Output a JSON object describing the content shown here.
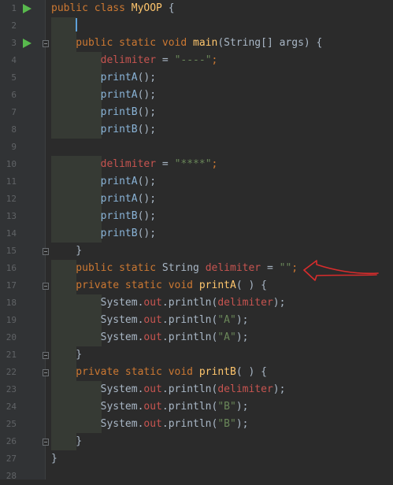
{
  "editor": {
    "line_numbers": [
      "1",
      "2",
      "3",
      "4",
      "5",
      "6",
      "7",
      "8",
      "9",
      "10",
      "11",
      "12",
      "13",
      "14",
      "15",
      "16",
      "17",
      "18",
      "19",
      "20",
      "21",
      "22",
      "23",
      "24",
      "25",
      "26",
      "27",
      "28"
    ],
    "gutter_icons": {
      "run": "run-icon",
      "fold": "fold-icon"
    },
    "lines": {
      "l1": {
        "a": "public class ",
        "b": "MyOOP",
        "c": " {"
      },
      "l3": {
        "a": "    public static void ",
        "b": "main",
        "c": "(String[] args) {"
      },
      "l4": {
        "a": "        ",
        "b": "delimiter",
        "c": " = ",
        "d": "\"----\"",
        "e": ";"
      },
      "l5": {
        "a": "        ",
        "b": "printA",
        "c": "();"
      },
      "l6": {
        "a": "        ",
        "b": "printA",
        "c": "();"
      },
      "l7": {
        "a": "        ",
        "b": "printB",
        "c": "();"
      },
      "l8": {
        "a": "        ",
        "b": "printB",
        "c": "();"
      },
      "l10": {
        "a": "        ",
        "b": "delimiter",
        "c": " = ",
        "d": "\"****\"",
        "e": ";"
      },
      "l11": {
        "a": "        ",
        "b": "printA",
        "c": "();"
      },
      "l12": {
        "a": "        ",
        "b": "printA",
        "c": "();"
      },
      "l13": {
        "a": "        ",
        "b": "printB",
        "c": "();"
      },
      "l14": {
        "a": "        ",
        "b": "printB",
        "c": "();"
      },
      "l15": {
        "a": "    }"
      },
      "l16": {
        "a": "    public static ",
        "b": "String ",
        "c": "delimiter",
        "d": " = ",
        "e": "\"\"",
        "f": ";"
      },
      "l17": {
        "a": "    private static void ",
        "b": "printA",
        "c": "( ) {"
      },
      "l18": {
        "a": "        System.",
        "b": "out",
        "c": ".println(",
        "d": "delimiter",
        "e": ");"
      },
      "l19": {
        "a": "        System.",
        "b": "out",
        "c": ".println(",
        "d": "\"A\"",
        "e": ");"
      },
      "l20": {
        "a": "        System.",
        "b": "out",
        "c": ".println(",
        "d": "\"A\"",
        "e": ");"
      },
      "l21": {
        "a": "    }"
      },
      "l22": {
        "a": "    private static void ",
        "b": "printB",
        "c": "( ) {"
      },
      "l23": {
        "a": "        System.",
        "b": "out",
        "c": ".println(",
        "d": "delimiter",
        "e": ");"
      },
      "l24": {
        "a": "        System.",
        "b": "out",
        "c": ".println(",
        "d": "\"B\"",
        "e": ");"
      },
      "l25": {
        "a": "        System.",
        "b": "out",
        "c": ".println(",
        "d": "\"B\"",
        "e": ");"
      },
      "l26": {
        "a": "    }"
      },
      "l27": {
        "a": "}"
      }
    }
  },
  "colors": {
    "background": "#2b2b2b",
    "keyword": "#cc7832",
    "class_or_method_decl": "#ffc66d",
    "field": "#c75450",
    "string": "#6a8759",
    "method_call": "#8ab4d8",
    "annotation_arrow": "#d92c2c"
  }
}
